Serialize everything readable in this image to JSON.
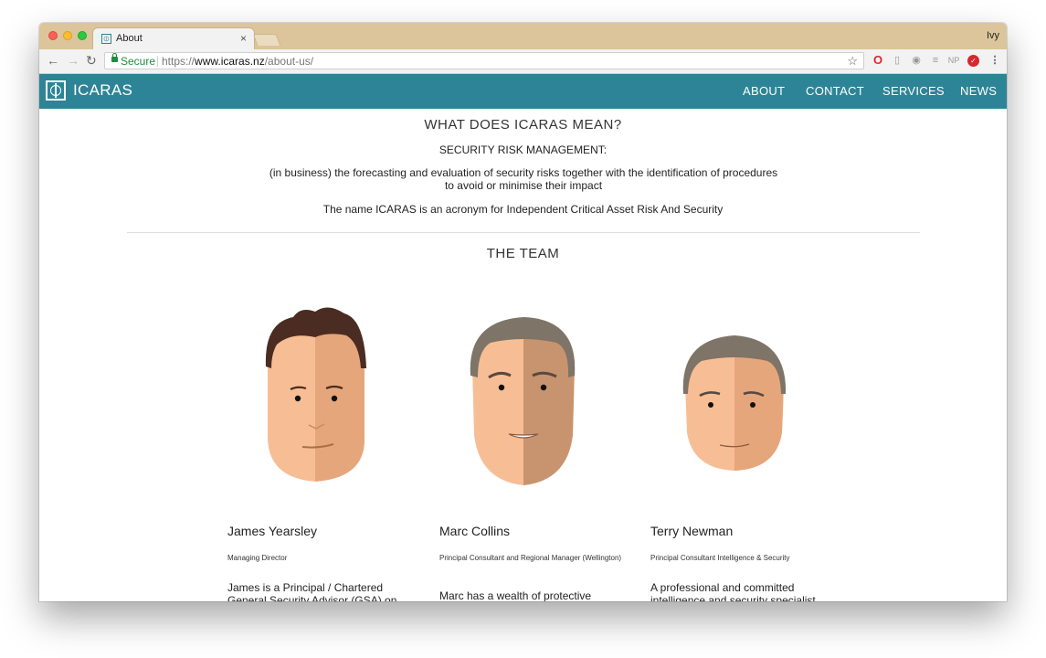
{
  "browser": {
    "tab_title": "About",
    "tab_close": "×",
    "profile_name": "Ivy",
    "secure_label": "Secure",
    "url_scheme": "https://",
    "url_host": "www.icaras.nz",
    "url_path": "/about-us/",
    "extensions": [
      "opera-icon",
      "document-icon",
      "eye-icon",
      "reader-icon",
      "np-icon",
      "red-extension-icon"
    ],
    "np_text": "NP"
  },
  "site": {
    "logo_text": "ICARAS",
    "nav": [
      "ABOUT",
      "CONTACT",
      "SERVICES",
      "NEWS"
    ],
    "brand_color": "#2e8497"
  },
  "meaning": {
    "title": "WHAT DOES ICARAS MEAN?",
    "subtitle": "SECURITY RISK MANAGEMENT:",
    "definition": "(in business) the forecasting and evaluation of security risks together with the identification of procedures to avoid or minimise their impact",
    "acronym": "The name ICARAS is an acronym for Independent Critical Asset Risk And Security"
  },
  "team": {
    "title": "THE TEAM",
    "members": [
      {
        "name": "James Yearsley",
        "role": "Managing Director",
        "bio": "James is a Principal / Chartered General Security Advisor (GSA) on"
      },
      {
        "name": "Marc Collins",
        "role": "Principal Consultant and Regional Manager (Wellington)",
        "bio": "Marc has a wealth of protective security and ..."
      },
      {
        "name": "Terry Newman",
        "role": "Principal Consultant Intelligence & Security",
        "bio": "A professional and committed intelligence and security specialist"
      }
    ]
  }
}
